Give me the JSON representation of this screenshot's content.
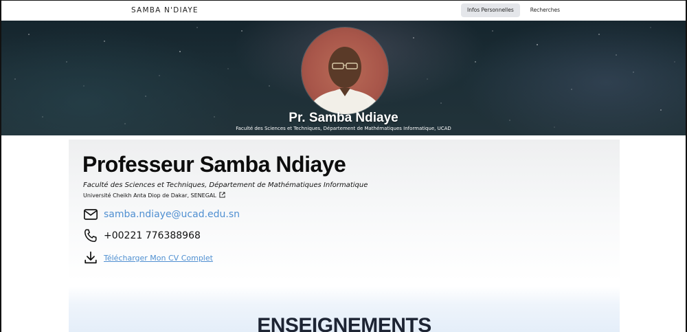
{
  "navbar": {
    "brand": "SAMBA N'DIAYE",
    "tabs": [
      {
        "label": "Infos Personnelles",
        "active": true
      },
      {
        "label": "Recherches",
        "active": false
      }
    ]
  },
  "hero": {
    "name": "Pr. Samba Ndiaye",
    "subtitle": "Faculté des Sciences et Techniques, Département de Mathématiques Informatique, UCAD"
  },
  "profile": {
    "title": "Professeur Samba Ndiaye",
    "faculty": "Faculté des Sciences et Techniques, Département de Mathématiques Informatique",
    "university": "Université Cheikh Anta Diop de Dakar, SENEGAL",
    "email": "samba.ndiaye@ucad.edu.sn",
    "phone": "+00221 776388968",
    "cv_label": "Télécharger Mon CV Complet"
  },
  "section": {
    "title": "ENSEIGNEMENTS"
  },
  "colors": {
    "link": "#4f8fd1",
    "active_tab_bg": "#e4e6ea",
    "section_title": "#1d2433"
  }
}
